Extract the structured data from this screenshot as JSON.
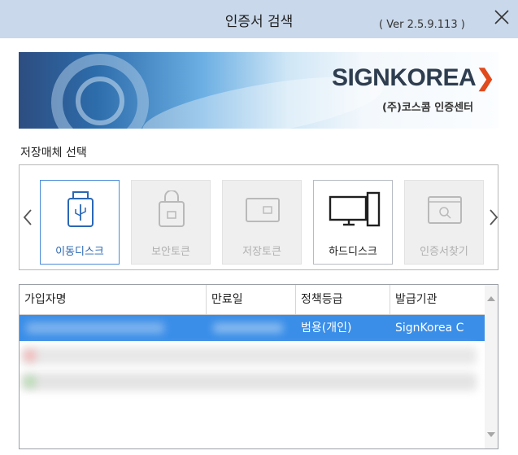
{
  "window": {
    "title": "인증서 검색",
    "version": "( Ver 2.5.9.113 )"
  },
  "banner": {
    "brand": "SIGNKOREA",
    "brand_arrow": "❯",
    "subtitle": "(주)코스콤 인증센터"
  },
  "media_section": {
    "label": "저장매체 선택",
    "items": [
      {
        "label": "이동디스크",
        "icon": "usb-drive-icon",
        "state": "selected"
      },
      {
        "label": "보안토큰",
        "icon": "security-token-icon",
        "state": "disabled"
      },
      {
        "label": "저장토큰",
        "icon": "storage-token-icon",
        "state": "disabled"
      },
      {
        "label": "하드디스크",
        "icon": "hard-disk-icon",
        "state": "enabled"
      },
      {
        "label": "인증서찾기",
        "icon": "cert-search-icon",
        "state": "disabled"
      }
    ]
  },
  "cert_table": {
    "columns": [
      "가입자명",
      "만료일",
      "정책등급",
      "발급기관"
    ],
    "selected_row": {
      "policy": "범용(개인)",
      "issuer": "SignKorea C"
    }
  },
  "colors": {
    "titlebar": "#c9d8ea",
    "selection": "#3a8ee8",
    "selected_border": "#4a8cd8",
    "brand_accent": "#e04a1c"
  }
}
